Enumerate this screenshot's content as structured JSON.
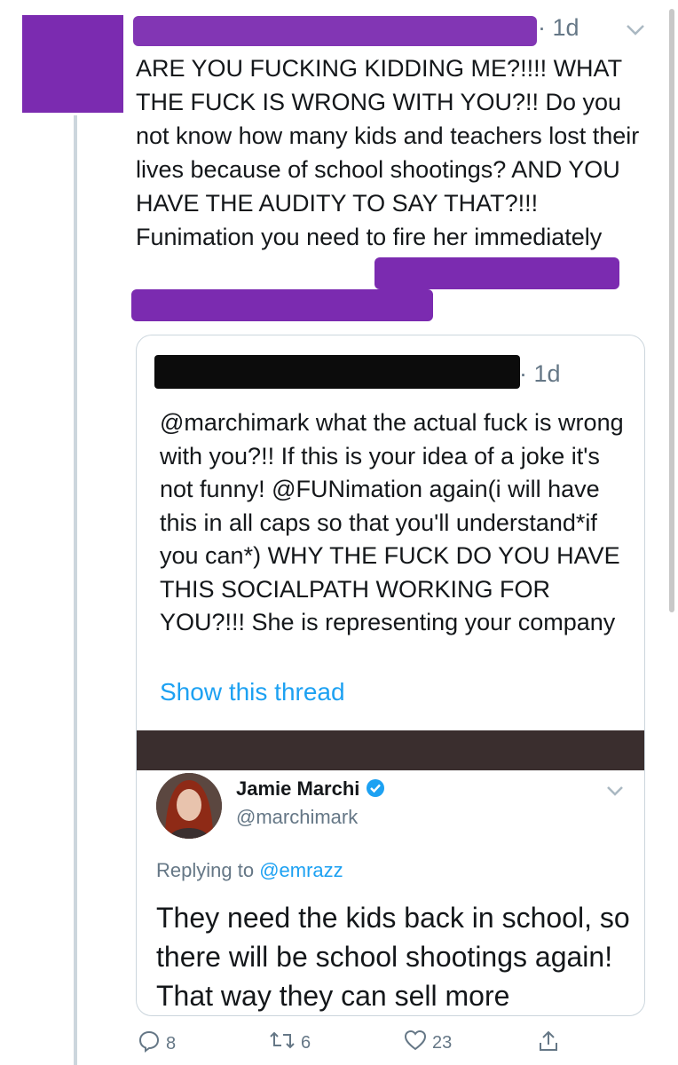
{
  "tweet": {
    "time": "· 1d",
    "text": "ARE YOU FUCKING KIDDING ME?!!!! WHAT THE FUCK IS WRONG WITH YOU?!! Do you not know how many kids and teachers lost their lives because of school shootings? AND YOU HAVE THE AUDITY TO SAY THAT?!!! Funimation you need to fire her immediately"
  },
  "quoted": {
    "time": "· 1d",
    "text": "@marchimark what the actual fuck is wrong with you?!! If this is your idea of a joke it's not funny! @FUNimation again(i will have this in all caps so that you'll understand*if you can*) WHY THE FUCK DO YOU HAVE THIS SOCIALPATH WORKING FOR YOU?!!! She is representing your company",
    "show_thread": "Show this thread",
    "embedded": {
      "name": "Jamie Marchi",
      "handle": "@marchimark",
      "replying_label": "Replying to",
      "replying_handle": "@emrazz",
      "text": "They need the kids back in school, so there will be school shootings again! That way they can sell more"
    }
  },
  "actions": {
    "replies": "8",
    "retweets": "6",
    "likes": "23"
  },
  "colors": {
    "accent": "#1da1f2",
    "redaction_purple": "#7b2bb0",
    "secondary_text": "#657786"
  }
}
